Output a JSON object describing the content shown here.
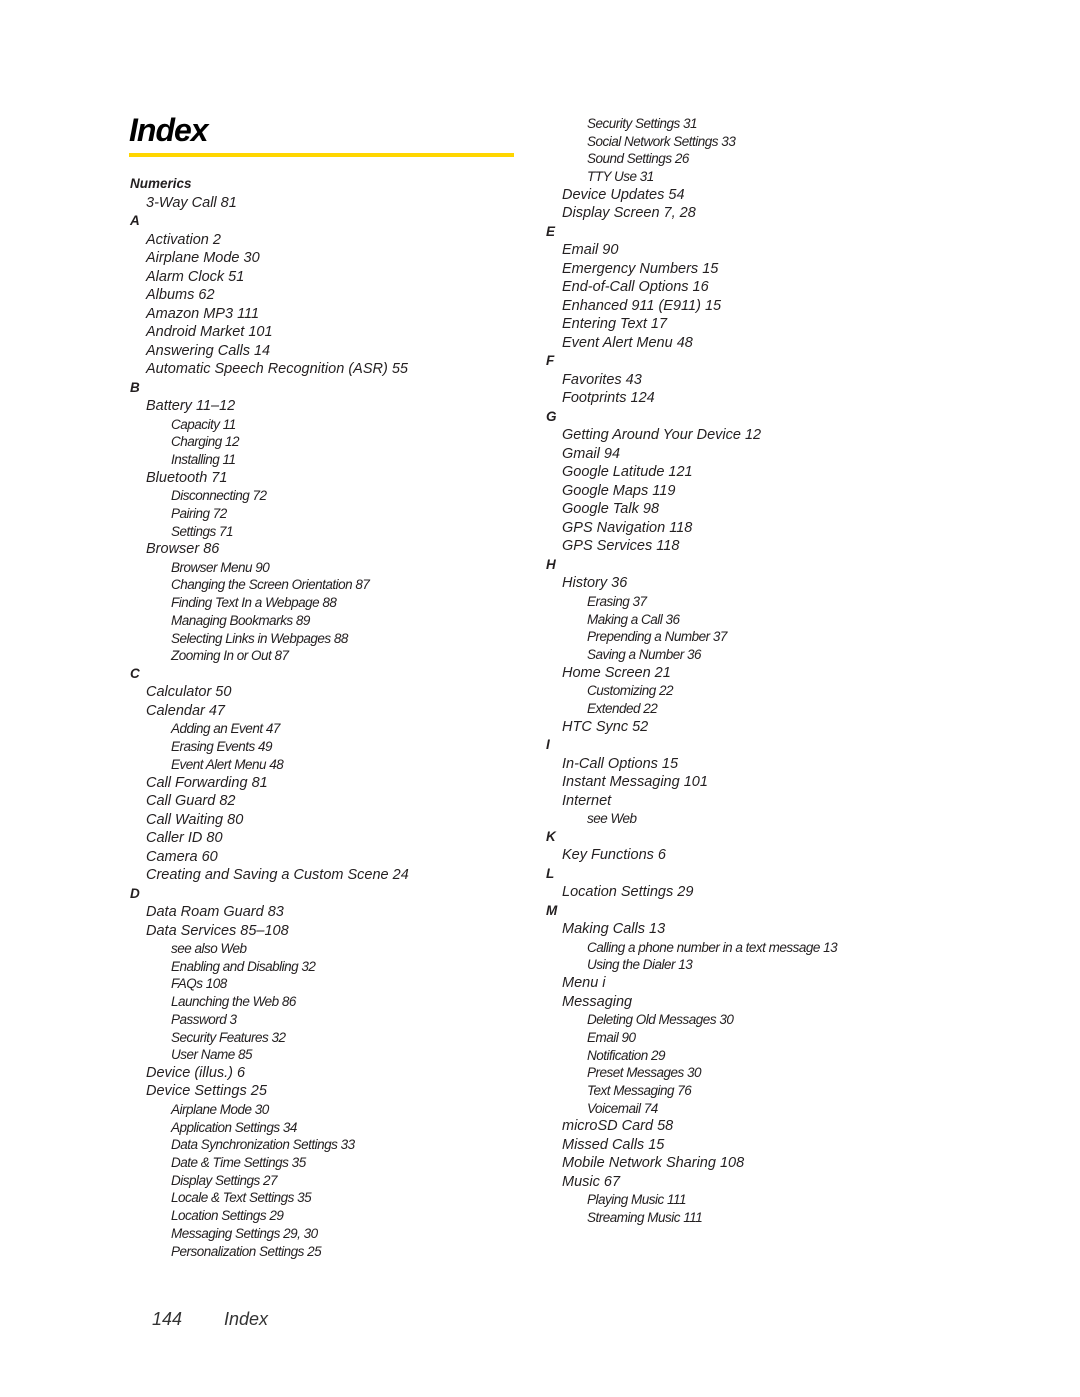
{
  "page": {
    "title": "Index",
    "accent_color": "#ffd600",
    "footer": {
      "page_number": "144",
      "section": "Index"
    }
  },
  "left_column": [
    {
      "t": "letter",
      "text": "Numerics"
    },
    {
      "t": "lvl1",
      "text": "3-Way Call 81"
    },
    {
      "t": "letter",
      "text": "A"
    },
    {
      "t": "lvl1",
      "text": "Activation 2"
    },
    {
      "t": "lvl1",
      "text": "Airplane Mode 30"
    },
    {
      "t": "lvl1",
      "text": "Alarm Clock 51"
    },
    {
      "t": "lvl1",
      "text": "Albums 62"
    },
    {
      "t": "lvl1",
      "text": "Amazon MP3 111"
    },
    {
      "t": "lvl1",
      "text": "Android Market 101"
    },
    {
      "t": "lvl1",
      "text": "Answering Calls 14"
    },
    {
      "t": "lvl1",
      "text": "Automatic Speech Recognition (ASR) 55"
    },
    {
      "t": "letter",
      "text": "B"
    },
    {
      "t": "lvl1",
      "text": "Battery 11–12"
    },
    {
      "t": "lvl2",
      "text": "Capacity 11"
    },
    {
      "t": "lvl2",
      "text": "Charging 12"
    },
    {
      "t": "lvl2",
      "text": "Installing 11"
    },
    {
      "t": "lvl1",
      "text": "Bluetooth 71"
    },
    {
      "t": "lvl2",
      "text": "Disconnecting 72"
    },
    {
      "t": "lvl2",
      "text": "Pairing 72"
    },
    {
      "t": "lvl2",
      "text": "Settings 71"
    },
    {
      "t": "lvl1",
      "text": "Browser 86"
    },
    {
      "t": "lvl2",
      "text": "Browser Menu 90"
    },
    {
      "t": "lvl2",
      "text": "Changing the Screen Orientation 87"
    },
    {
      "t": "lvl2",
      "text": "Finding Text In a Webpage 88"
    },
    {
      "t": "lvl2",
      "text": "Managing Bookmarks 89"
    },
    {
      "t": "lvl2",
      "text": "Selecting Links in Webpages 88"
    },
    {
      "t": "lvl2",
      "text": "Zooming In or Out 87"
    },
    {
      "t": "letter",
      "text": "C"
    },
    {
      "t": "lvl1",
      "text": "Calculator 50"
    },
    {
      "t": "lvl1",
      "text": "Calendar 47"
    },
    {
      "t": "lvl2",
      "text": "Adding an Event 47"
    },
    {
      "t": "lvl2",
      "text": "Erasing Events 49"
    },
    {
      "t": "lvl2",
      "text": "Event Alert Menu 48"
    },
    {
      "t": "lvl1",
      "text": "Call Forwarding 81"
    },
    {
      "t": "lvl1",
      "text": "Call Guard 82"
    },
    {
      "t": "lvl1",
      "text": "Call Waiting 80"
    },
    {
      "t": "lvl1",
      "text": "Caller ID 80"
    },
    {
      "t": "lvl1",
      "text": "Camera 60"
    },
    {
      "t": "lvl1",
      "text": "Creating and Saving a Custom Scene 24"
    },
    {
      "t": "letter",
      "text": "D"
    },
    {
      "t": "lvl1",
      "text": "Data Roam Guard 83"
    },
    {
      "t": "lvl1",
      "text": "Data Services 85–108"
    },
    {
      "t": "lvl2",
      "text": "see also Web"
    },
    {
      "t": "lvl2",
      "text": "Enabling and Disabling 32"
    },
    {
      "t": "lvl2",
      "text": "FAQs 108"
    },
    {
      "t": "lvl2",
      "text": "Launching the Web 86"
    },
    {
      "t": "lvl2",
      "text": "Password 3"
    },
    {
      "t": "lvl2",
      "text": "Security Features 32"
    },
    {
      "t": "lvl2",
      "text": "User Name 85"
    },
    {
      "t": "lvl1",
      "text": "Device (illus.) 6"
    },
    {
      "t": "lvl1",
      "text": "Device Settings 25"
    },
    {
      "t": "lvl2",
      "text": "Airplane Mode 30"
    },
    {
      "t": "lvl2",
      "text": "Application Settings 34"
    },
    {
      "t": "lvl2",
      "text": "Data Synchronization Settings 33"
    },
    {
      "t": "lvl2",
      "text": "Date & Time Settings 35"
    },
    {
      "t": "lvl2",
      "text": "Display Settings 27"
    },
    {
      "t": "lvl2",
      "text": "Locale & Text Settings 35"
    },
    {
      "t": "lvl2",
      "text": "Location Settings 29"
    },
    {
      "t": "lvl2",
      "text": "Messaging Settings 29, 30"
    },
    {
      "t": "lvl2",
      "text": "Personalization Settings 25"
    }
  ],
  "right_column": [
    {
      "t": "lvl2",
      "text": "Security Settings 31"
    },
    {
      "t": "lvl2",
      "text": "Social Network Settings 33"
    },
    {
      "t": "lvl2",
      "text": "Sound Settings 26"
    },
    {
      "t": "lvl2",
      "text": "TTY Use 31"
    },
    {
      "t": "lvl1",
      "text": "Device Updates 54"
    },
    {
      "t": "lvl1",
      "text": "Display Screen 7, 28"
    },
    {
      "t": "letter",
      "text": "E"
    },
    {
      "t": "lvl1",
      "text": "Email 90"
    },
    {
      "t": "lvl1",
      "text": "Emergency Numbers 15"
    },
    {
      "t": "lvl1",
      "text": "End-of-Call Options 16"
    },
    {
      "t": "lvl1",
      "text": "Enhanced 911 (E911) 15"
    },
    {
      "t": "lvl1",
      "text": "Entering Text 17"
    },
    {
      "t": "lvl1",
      "text": "Event Alert Menu 48"
    },
    {
      "t": "letter",
      "text": "F"
    },
    {
      "t": "lvl1",
      "text": "Favorites 43"
    },
    {
      "t": "lvl1",
      "text": "Footprints 124"
    },
    {
      "t": "letter",
      "text": "G"
    },
    {
      "t": "lvl1",
      "text": "Getting Around Your Device 12"
    },
    {
      "t": "lvl1",
      "text": "Gmail 94"
    },
    {
      "t": "lvl1",
      "text": "Google Latitude 121"
    },
    {
      "t": "lvl1",
      "text": "Google Maps 119"
    },
    {
      "t": "lvl1",
      "text": "Google Talk 98"
    },
    {
      "t": "lvl1",
      "text": "GPS Navigation 118"
    },
    {
      "t": "lvl1",
      "text": "GPS Services 118"
    },
    {
      "t": "letter",
      "text": "H"
    },
    {
      "t": "lvl1",
      "text": "History 36"
    },
    {
      "t": "lvl2",
      "text": "Erasing 37"
    },
    {
      "t": "lvl2",
      "text": "Making a Call 36"
    },
    {
      "t": "lvl2",
      "text": "Prepending a Number 37"
    },
    {
      "t": "lvl2",
      "text": "Saving a Number 36"
    },
    {
      "t": "lvl1",
      "text": "Home Screen 21"
    },
    {
      "t": "lvl2",
      "text": "Customizing 22"
    },
    {
      "t": "lvl2",
      "text": "Extended 22"
    },
    {
      "t": "lvl1",
      "text": "HTC Sync 52"
    },
    {
      "t": "letter",
      "text": "I"
    },
    {
      "t": "lvl1",
      "text": "In-Call Options 15"
    },
    {
      "t": "lvl1",
      "text": "Instant Messaging 101"
    },
    {
      "t": "lvl1",
      "text": "Internet"
    },
    {
      "t": "lvl2",
      "text": "see Web"
    },
    {
      "t": "letter",
      "text": "K"
    },
    {
      "t": "lvl1",
      "text": "Key Functions 6"
    },
    {
      "t": "letter",
      "text": "L"
    },
    {
      "t": "lvl1",
      "text": "Location Settings 29"
    },
    {
      "t": "letter",
      "text": "M"
    },
    {
      "t": "lvl1",
      "text": "Making Calls 13"
    },
    {
      "t": "lvl2",
      "text": "Calling a phone number in a text message 13"
    },
    {
      "t": "lvl2",
      "text": "Using the Dialer 13"
    },
    {
      "t": "lvl1",
      "text": "Menu i"
    },
    {
      "t": "lvl1",
      "text": "Messaging"
    },
    {
      "t": "lvl2",
      "text": "Deleting Old Messages 30"
    },
    {
      "t": "lvl2",
      "text": "Email 90"
    },
    {
      "t": "lvl2",
      "text": "Notification 29"
    },
    {
      "t": "lvl2",
      "text": "Preset Messages 30"
    },
    {
      "t": "lvl2",
      "text": "Text Messaging 76"
    },
    {
      "t": "lvl2",
      "text": "Voicemail 74"
    },
    {
      "t": "lvl1",
      "text": "microSD Card 58"
    },
    {
      "t": "lvl1",
      "text": "Missed Calls 15"
    },
    {
      "t": "lvl1",
      "text": "Mobile Network Sharing 108"
    },
    {
      "t": "lvl1",
      "text": "Music 67"
    },
    {
      "t": "lvl2",
      "text": "Playing Music 111"
    },
    {
      "t": "lvl2",
      "text": "Streaming Music 111"
    }
  ]
}
